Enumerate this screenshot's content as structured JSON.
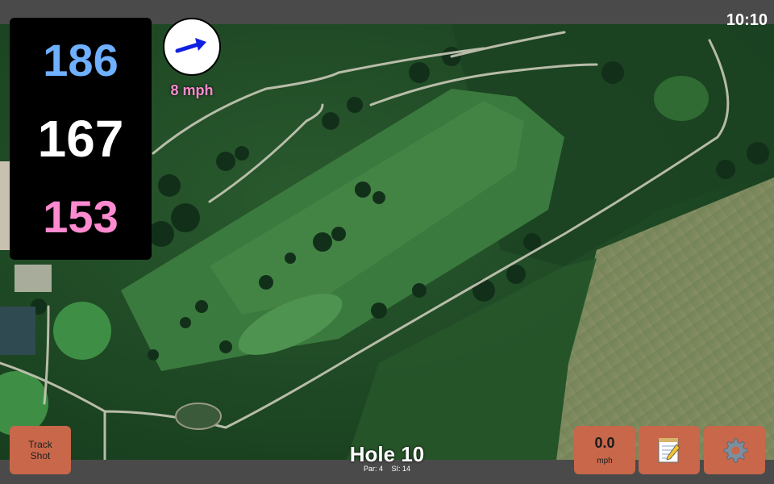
{
  "status": {
    "time": "10:10"
  },
  "distances": {
    "back": "186",
    "middle": "167",
    "front": "153",
    "colors": {
      "back": "#6fb0ff",
      "middle": "#ffffff",
      "front": "#ff8ad0"
    }
  },
  "wind": {
    "speed_label": "8 mph",
    "direction_icon": "wind-arrow-icon",
    "arrow_color": "#1020e0"
  },
  "hole": {
    "title": "Hole 10",
    "par_label": "Par: 4",
    "si_label": "SI: 14"
  },
  "buttons": {
    "track_shot_line1": "Track",
    "track_shot_line2": "Shot",
    "speed_value": "0.0",
    "speed_unit": "mph",
    "notes_icon": "notepad-icon",
    "settings_icon": "gear-icon",
    "accent_color": "#c8674a"
  },
  "map": {
    "style": "satellite"
  }
}
